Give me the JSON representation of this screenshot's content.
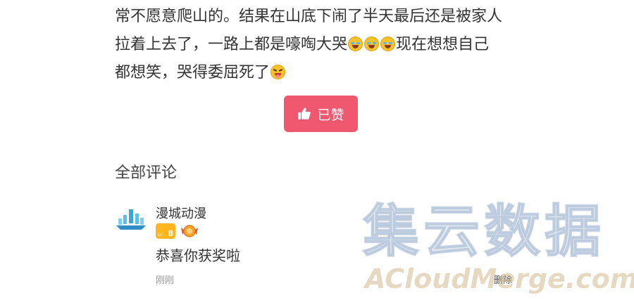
{
  "post": {
    "line1": "常不愿意爬山的。结果在山底下闹了半天最后还是被家人",
    "line2_before": "拉着上去了，一路上都是嚎啕大哭",
    "line2_after": "现在想想自己",
    "line3_before": "都想笑，哭得委屈死了",
    "emoji_laugh_cry": "laugh-cry-emoji",
    "emoji_tongue": "squint-tongue-emoji"
  },
  "like_button": {
    "label": "已赞",
    "icon": "thumbs-up-icon",
    "color": "#f0586f"
  },
  "comments": {
    "title": "全部评论",
    "items": [
      {
        "username": "漫城动漫",
        "level_badge": "8",
        "level_prefix": "LV",
        "text": "恭喜你获奖啦",
        "time": "刚刚",
        "delete_label": "删除"
      }
    ]
  },
  "watermark": {
    "cn": "集云数据",
    "en": "ACloudMerge.com"
  }
}
